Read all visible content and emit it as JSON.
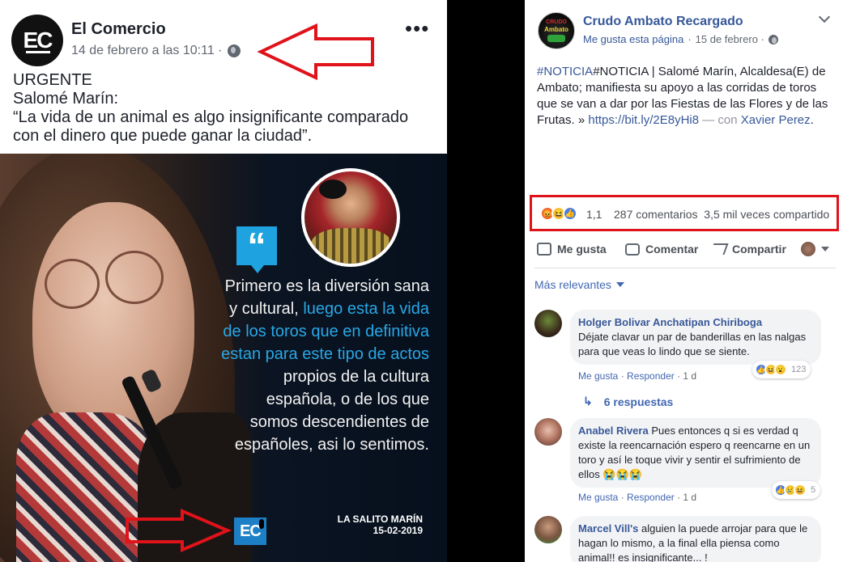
{
  "left_post": {
    "avatar_text": "EC",
    "page_name": "El Comercio",
    "date": "14 de febrero a las 10:11 ·",
    "more_label": "•••",
    "text_lines": [
      "URGENTE",
      "Salomé Marín:",
      "“La vida de un animal es algo insignificante comparado",
      "con el dinero que puede ganar la ciudad”."
    ],
    "image": {
      "quote_mark": "“",
      "quote_part1": "Primero es la diversión sana y cultural, ",
      "quote_highlight": "luego esta la vida de los toros que en definitiva estan para este tipo de actos",
      "quote_part2": " propios de la cultura española, o de los que somos descendientes de españoles, asi lo sentimos.",
      "caption_name": "LA SALITO MARÍN",
      "caption_date": "15-02-2019",
      "logo_text": "EC",
      "highlight_color": "#29a7e6"
    },
    "annotation_color": "#e0121a"
  },
  "right_post": {
    "avatar_lines": [
      "CRUDO",
      "Ambato",
      ""
    ],
    "page_name": "Crudo Ambato Recargado",
    "meta_like": "Me gusta esta página",
    "meta_date": "15 de febrero ·",
    "body_prefix": "#NOTICIA | Salomé Marín, Alcaldesa(E) de Ambato; manifiesta su apoyo a las corridas de toros que se van a dar por las Fiestas de las Flores y de las Frutas. » ",
    "body_link": "https://bit.ly/2E8yHi8",
    "body_with": " — con ",
    "body_tag": "Xavier Perez",
    "body_end": ".",
    "reactions": {
      "icons": [
        "angry-icon",
        "haha-icon",
        "like-icon"
      ],
      "count": "1,1",
      "comments": "287 comentarios",
      "shares": "3,5 mil veces compartido"
    },
    "actions": {
      "like": "Me gusta",
      "comment": "Comentar",
      "share": "Compartir"
    },
    "sort_label": "Más relevantes",
    "comments": [
      {
        "name": "Holger Bolivar Anchatipan Chiriboga",
        "text": "Déjate clavar un par de banderillas en las nalgas para que veas lo lindo que se siente.",
        "like": "Me gusta",
        "reply": "Responder",
        "time": "1 d",
        "reaction_count": "123",
        "replies": "6 respuestas"
      },
      {
        "name": "Anabel Rivera",
        "text": " Pues entonces q si es verdad q existe la reencarnación espero q reencarne en un toro y así le toque vivir y sentir el sufrimiento de ellos 😭😭😭",
        "like": "Me gusta",
        "reply": "Responder",
        "time": "1 d",
        "reaction_count": "5"
      },
      {
        "name": "Marcel Vill's",
        "text": " alguien la puede arrojar para que le hagan lo mismo, a la final ella piensa como animal!! es insignificante... !",
        "like": "",
        "reply": "",
        "time": ""
      }
    ],
    "link_color": "#365899"
  }
}
